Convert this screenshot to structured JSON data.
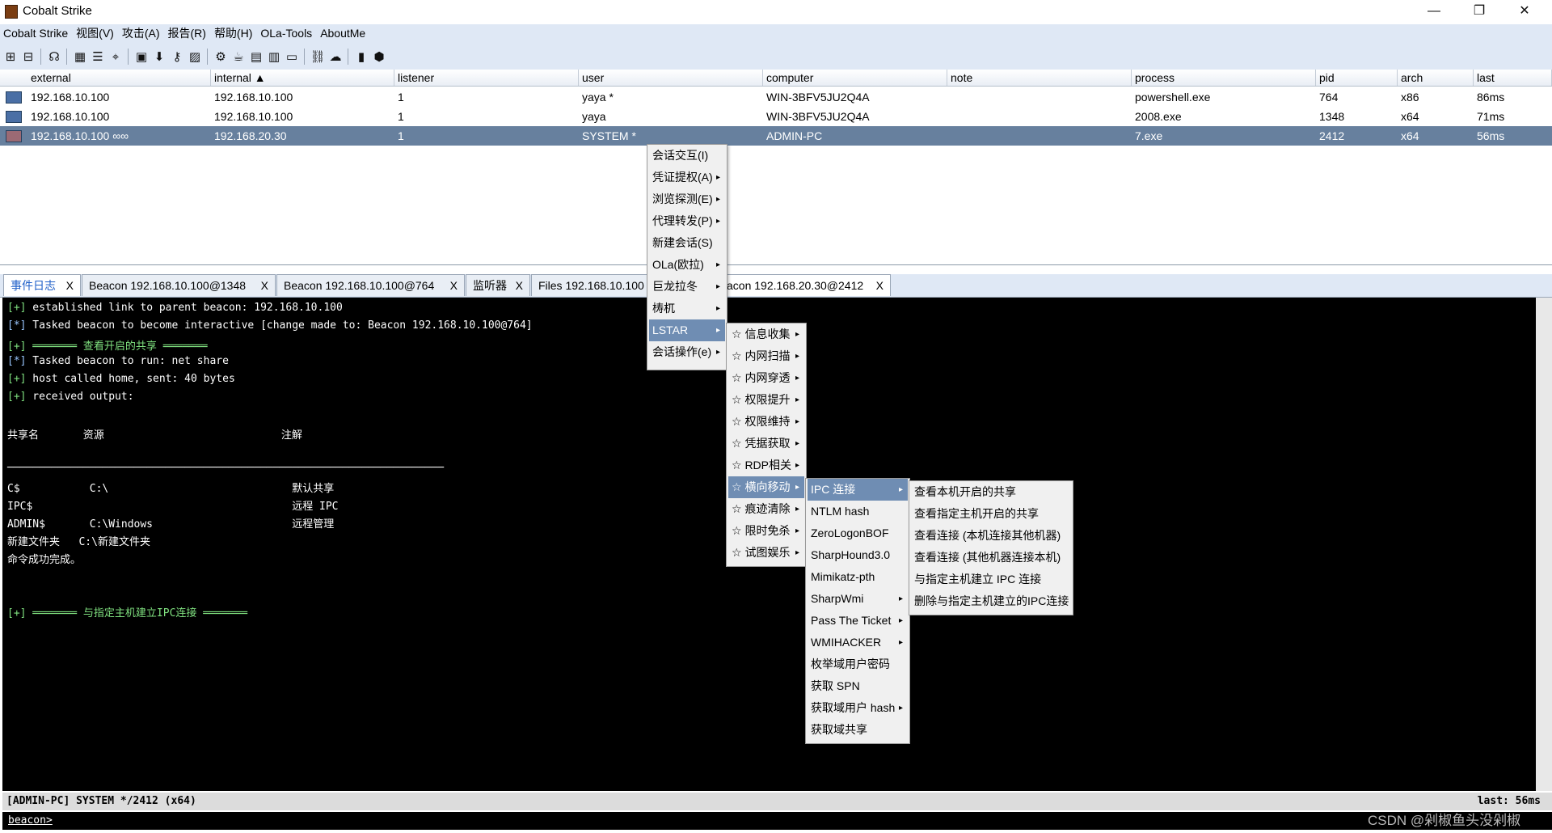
{
  "window": {
    "title": "Cobalt Strike",
    "minimize": "—",
    "restore": "❐",
    "close": "✕"
  },
  "menubar": [
    "Cobalt Strike",
    "视图(V)",
    "攻击(A)",
    "报告(R)",
    "帮助(H)",
    "OLa-Tools",
    "AboutMe"
  ],
  "table": {
    "headers": [
      "external",
      "internal ▲",
      "listener",
      "user",
      "computer",
      "note",
      "process",
      "pid",
      "arch",
      "last"
    ],
    "rows": [
      [
        "192.168.10.100",
        "192.168.10.100",
        "1",
        "yaya *",
        "WIN-3BFV5JU2Q4A",
        "",
        "powershell.exe",
        "764",
        "x86",
        "86ms"
      ],
      [
        "192.168.10.100",
        "192.168.10.100",
        "1",
        "yaya",
        "WIN-3BFV5JU2Q4A",
        "",
        "2008.exe",
        "1348",
        "x64",
        "71ms"
      ],
      [
        "192.168.10.100 ∞∞",
        "192.168.20.30",
        "1",
        "SYSTEM *",
        "ADMIN-PC",
        "",
        "7.exe",
        "2412",
        "x64",
        "56ms"
      ]
    ]
  },
  "tabs": [
    {
      "label": "事件日志",
      "close": "X"
    },
    {
      "label": "Beacon 192.168.10.100@1348",
      "close": "X"
    },
    {
      "label": "Beacon 192.168.10.100@764",
      "close": "X"
    },
    {
      "label": "监听器",
      "close": "X"
    },
    {
      "label": "Files 192.168.10.100",
      "close": ""
    },
    {
      "label": "acon 192.168.20.30@2412",
      "close": "X"
    }
  ],
  "console": {
    "lines": [
      {
        "p": "[+]",
        "t": " established link to parent beacon: 192.168.10.100",
        "c": "g"
      },
      {
        "p": "[*]",
        "t": " Tasked beacon to become interactive [change made to: Beacon 192.168.10.100@764]",
        "c": "b"
      },
      {
        "p": "[+]",
        "t": " ═══════ 查看开启的共享 ═══════",
        "c": "g",
        "gt": true
      },
      {
        "p": "[*]",
        "t": " Tasked beacon to run: net share",
        "c": "b"
      },
      {
        "p": "[+]",
        "t": " host called home, sent: 40 bytes",
        "c": "g"
      },
      {
        "p": "[+]",
        "t": " received output:",
        "c": "g"
      },
      {
        "p": "",
        "t": "",
        "c": ""
      },
      {
        "p": "",
        "t": "共享名       资源                            注解",
        "c": ""
      },
      {
        "p": "",
        "t": "",
        "c": ""
      },
      {
        "p": "",
        "t": "─────────────────────────────────────────────────────────────────────",
        "c": ""
      },
      {
        "p": "",
        "t": "C$           C:\\                             默认共享",
        "c": ""
      },
      {
        "p": "",
        "t": "IPC$                                         远程 IPC",
        "c": ""
      },
      {
        "p": "",
        "t": "ADMIN$       C:\\Windows                      远程管理",
        "c": ""
      },
      {
        "p": "",
        "t": "新建文件夹   C:\\新建文件夹",
        "c": ""
      },
      {
        "p": "",
        "t": "命令成功完成。",
        "c": ""
      },
      {
        "p": "",
        "t": "",
        "c": ""
      },
      {
        "p": "",
        "t": "",
        "c": ""
      },
      {
        "p": "[+]",
        "t": " ═══════ 与指定主机建立IPC连接 ═══════",
        "c": "g",
        "gt": true
      }
    ]
  },
  "status": {
    "left": "[ADMIN-PC] SYSTEM */2412 (x64)",
    "right": "last: 56ms"
  },
  "prompt": "beacon>",
  "watermark": "CSDN @剁椒鱼头没剁椒",
  "menus": {
    "main": [
      {
        "label": "会话交互(I)",
        "sub": false
      },
      {
        "label": "凭证提权(A)",
        "sub": true
      },
      {
        "label": "浏览探测(E)",
        "sub": true
      },
      {
        "label": "代理转发(P)",
        "sub": true
      },
      {
        "label": "新建会话(S)",
        "sub": false
      },
      {
        "label": "OLa(欧拉)",
        "sub": true
      },
      {
        "label": "巨龙拉冬",
        "sub": true
      },
      {
        "label": "梼杌",
        "sub": true
      },
      {
        "label": "LSTAR",
        "sub": true,
        "hl": true
      },
      {
        "label": "会话操作(e)",
        "sub": true
      }
    ],
    "lstar": [
      {
        "label": "☆ 信息收集",
        "sub": true
      },
      {
        "label": "☆ 内网扫描",
        "sub": true
      },
      {
        "label": "☆ 内网穿透",
        "sub": true
      },
      {
        "label": "☆ 权限提升",
        "sub": true
      },
      {
        "label": "☆ 权限维持",
        "sub": true
      },
      {
        "label": "☆ 凭据获取",
        "sub": true
      },
      {
        "label": "☆ RDP相关",
        "sub": true
      },
      {
        "label": "☆ 横向移动",
        "sub": true,
        "hl": true
      },
      {
        "label": "☆ 痕迹清除",
        "sub": true
      },
      {
        "label": "☆ 限时免杀",
        "sub": true
      },
      {
        "label": "☆ 试图娱乐",
        "sub": true
      }
    ],
    "lateral": [
      {
        "label": "IPC 连接",
        "sub": true,
        "hl": true
      },
      {
        "label": "NTLM hash",
        "sub": false
      },
      {
        "label": "ZeroLogonBOF",
        "sub": false
      },
      {
        "label": "SharpHound3.0",
        "sub": false
      },
      {
        "label": "Mimikatz-pth",
        "sub": false
      },
      {
        "label": "SharpWmi",
        "sub": true
      },
      {
        "label": "Pass The Ticket",
        "sub": true
      },
      {
        "label": "WMIHACKER",
        "sub": true
      },
      {
        "label": "枚举域用户密码",
        "sub": false
      },
      {
        "label": "获取 SPN",
        "sub": false
      },
      {
        "label": "获取域用户 hash",
        "sub": true
      },
      {
        "label": "获取域共享",
        "sub": false
      }
    ],
    "ipc": [
      {
        "label": "查看本机开启的共享",
        "sub": false
      },
      {
        "label": "查看指定主机开启的共享",
        "sub": false
      },
      {
        "label": "查看连接 (本机连接其他机器)",
        "sub": false
      },
      {
        "label": "查看连接 (其他机器连接本机)",
        "sub": false
      },
      {
        "label": "与指定主机建立 IPC 连接",
        "sub": false
      },
      {
        "label": "删除与指定主机建立的IPC连接",
        "sub": false
      }
    ]
  }
}
